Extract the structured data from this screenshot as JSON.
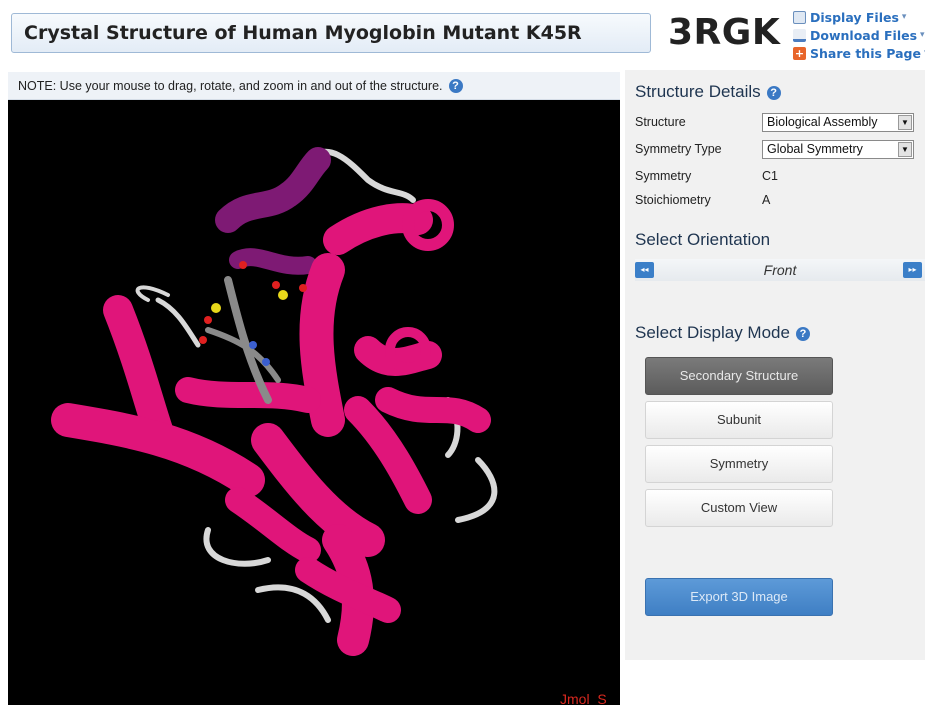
{
  "header": {
    "title": "Crystal Structure of Human Myoglobin Mutant K45R",
    "pdb_id": "3RGK",
    "links": [
      {
        "label": "Display Files",
        "icon": "document-icon"
      },
      {
        "label": "Download Files",
        "icon": "download-icon"
      },
      {
        "label": "Share this Page",
        "icon": "share-plus-icon"
      }
    ]
  },
  "viewer": {
    "note": "NOTE: Use your mouse to drag, rotate, and zoom in and out of the structure.",
    "watermark": "Jmol_S",
    "background": "#000000",
    "helix_color": "#e0157a",
    "helix_dark_color": "#7e1a74",
    "coil_color": "#d8d8d8"
  },
  "details": {
    "title": "Structure Details",
    "rows": [
      {
        "label": "Structure",
        "value": "Biological Assembly"
      },
      {
        "label": "Symmetry Type",
        "value": "Global Symmetry"
      },
      {
        "label": "Symmetry",
        "value": "C1"
      },
      {
        "label": "Stoichiometry",
        "value": "A"
      }
    ]
  },
  "orientation": {
    "title": "Select Orientation",
    "current": "Front",
    "prev": "◂◂",
    "next": "▸▸"
  },
  "display_mode": {
    "title": "Select Display Mode",
    "buttons": [
      "Secondary Structure",
      "Subunit",
      "Symmetry",
      "Custom View"
    ],
    "active": "Secondary Structure"
  },
  "export_label": "Export 3D Image",
  "accent": "#3b79c4"
}
